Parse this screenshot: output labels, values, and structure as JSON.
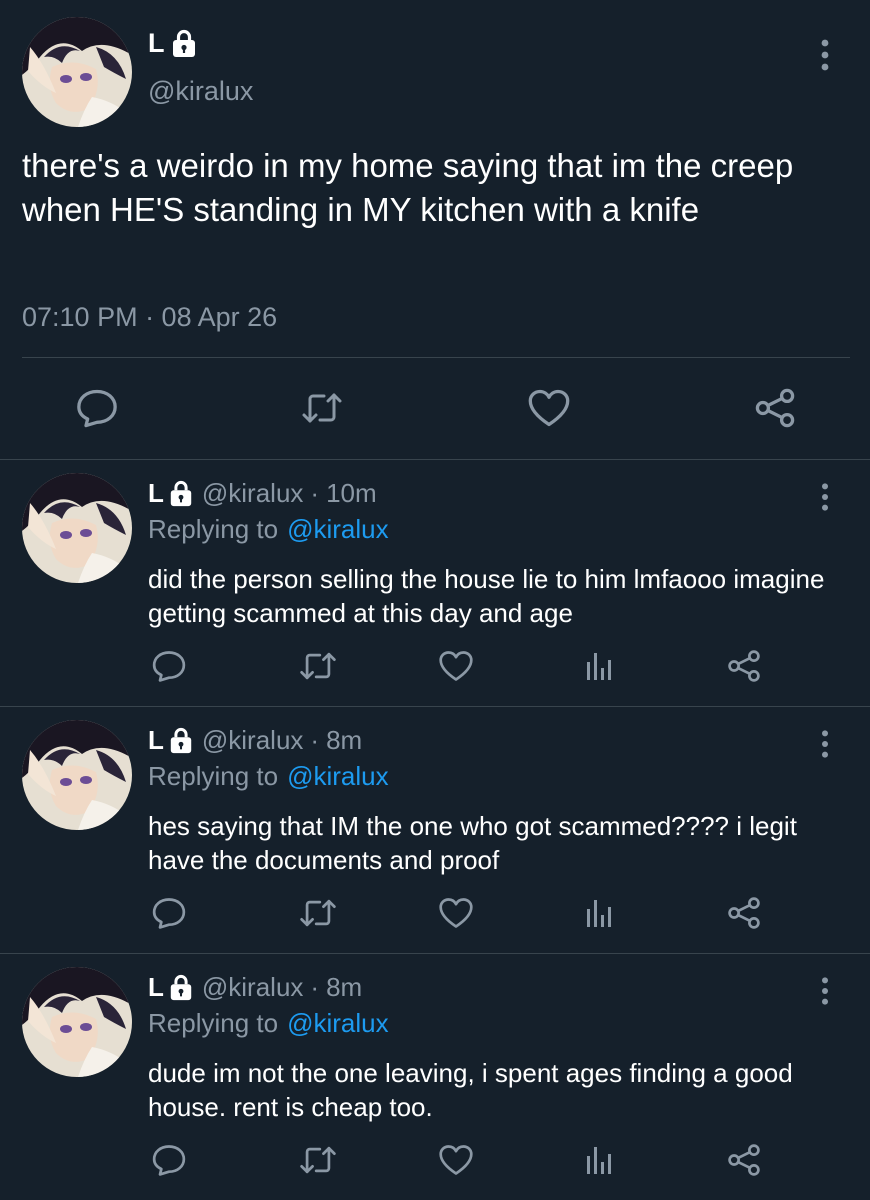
{
  "colors": {
    "background": "#15202b",
    "text": "#ffffff",
    "muted": "#8b98a5",
    "link": "#1d9bf0",
    "divider": "#38444d"
  },
  "main_tweet": {
    "name": "L",
    "handle": "@kiralux",
    "text": "there's a weirdo in my home saying that im the creep when HE'S standing in MY kitchen with a knife",
    "timestamp": "07:10 PM · 08 Apr 26",
    "icons": [
      "reply-icon",
      "retweet-icon",
      "like-icon",
      "share-icon",
      "more-icon",
      "lock-icon"
    ]
  },
  "replies": [
    {
      "name": "L",
      "handle": "@kiralux",
      "separator": "·",
      "time": "10m",
      "replying_label": "Replying to",
      "replying_to": "@kiralux",
      "text": "did the person selling the house lie to him lmfaooo imagine getting scammed at this day and age"
    },
    {
      "name": "L",
      "handle": "@kiralux",
      "separator": "·",
      "time": "8m",
      "replying_label": "Replying to",
      "replying_to": "@kiralux",
      "text": "hes saying that IM the one who got scammed???? i legit have the documents and proof"
    },
    {
      "name": "L",
      "handle": "@kiralux",
      "separator": "·",
      "time": "8m",
      "replying_label": "Replying to",
      "replying_to": "@kiralux",
      "text": "dude im not the one leaving, i spent ages finding a good house. rent is cheap too."
    }
  ]
}
